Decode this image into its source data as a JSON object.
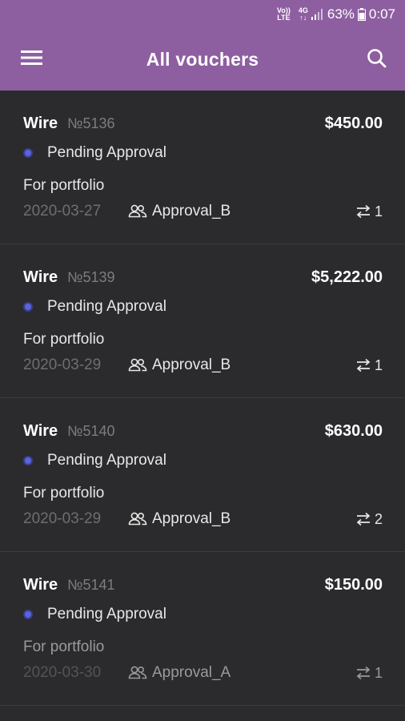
{
  "status_bar": {
    "network_top": "Vo))",
    "network_bottom": "LTE",
    "data_top": "4G",
    "data_bottom": "↑↓",
    "battery": "63%",
    "time": "0:07"
  },
  "header": {
    "title": "All vouchers",
    "menu_icon": "hamburger-menu-icon",
    "search_icon": "search-icon"
  },
  "vouchers": [
    {
      "type": "Wire",
      "number": "№5136",
      "amount": "$450.00",
      "status": "Pending Approval",
      "description": "For portfolio",
      "date": "2020-03-27",
      "approver": "Approval_B",
      "transfers": "1"
    },
    {
      "type": "Wire",
      "number": "№5139",
      "amount": "$5,222.00",
      "status": "Pending Approval",
      "description": "For portfolio",
      "date": "2020-03-29",
      "approver": "Approval_B",
      "transfers": "1"
    },
    {
      "type": "Wire",
      "number": "№5140",
      "amount": "$630.00",
      "status": "Pending Approval",
      "description": "For portfolio",
      "date": "2020-03-29",
      "approver": "Approval_B",
      "transfers": "2"
    },
    {
      "type": "Wire",
      "number": "№5141",
      "amount": "$150.00",
      "status": "Pending Approval",
      "description": "For portfolio",
      "date": "2020-03-30",
      "approver": "Approval_A",
      "transfers": "1"
    }
  ],
  "colors": {
    "header_bg": "#8e5fa0",
    "body_bg": "#2b2b2d",
    "status_dot": "#5a63e0"
  }
}
